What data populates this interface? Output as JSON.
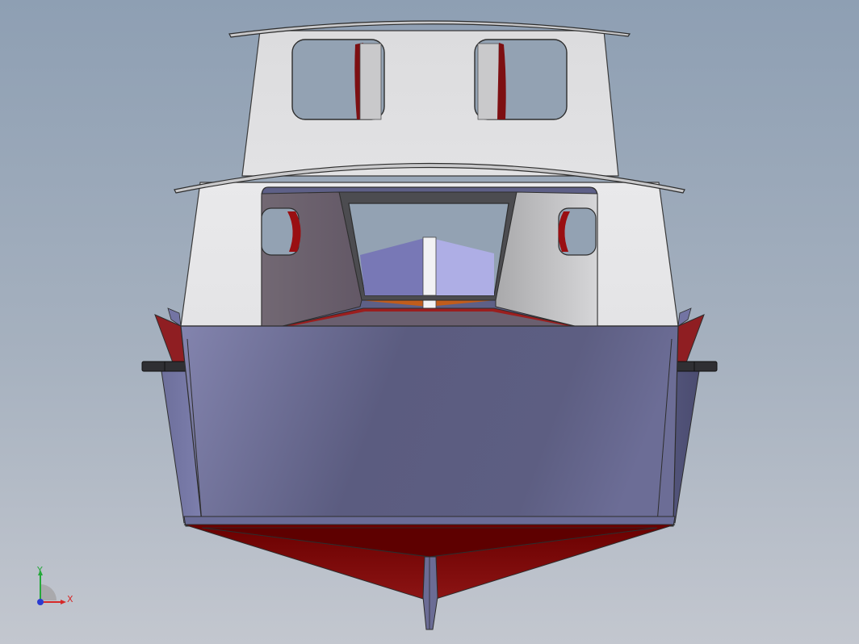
{
  "viewport": {
    "background_top": "#8e9fb3",
    "background_bottom": "#c3c7cf"
  },
  "model": {
    "hull_color": "#5c5f86",
    "bottom_color": "#7a0a0a",
    "cabin_color": "#dadbdd",
    "trim_color": "#9c1b1b",
    "rub_rail_color": "#2f2f33"
  },
  "triad": {
    "x_label": "X",
    "y_label": "Y",
    "x_color": "#d62828",
    "y_color": "#25a83a",
    "z_color": "#2b3bd1"
  }
}
